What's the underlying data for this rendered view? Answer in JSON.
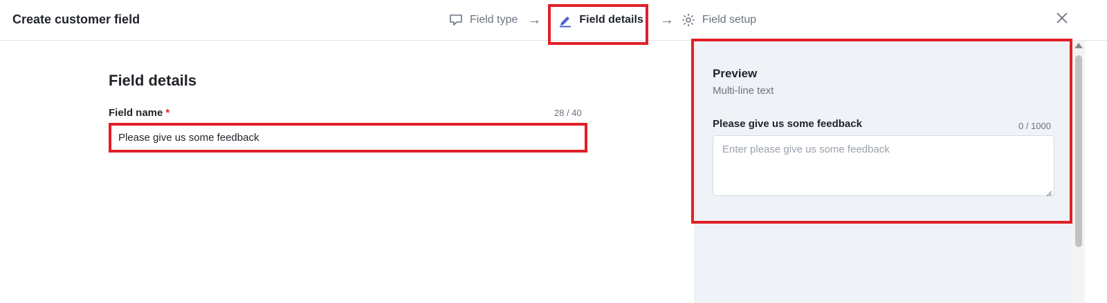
{
  "header": {
    "title": "Create customer field",
    "steps": [
      {
        "label": "Field type",
        "icon": "speech-bubble-icon",
        "active": false
      },
      {
        "label": "Field details",
        "icon": "pen-icon",
        "active": true
      },
      {
        "label": "Field setup",
        "icon": "gear-icon",
        "active": false
      }
    ],
    "arrow": "→",
    "close_icon": "close-icon"
  },
  "form": {
    "title": "Field details",
    "field_name_label": "Field name",
    "required_marker": "*",
    "field_name_counter": "28 / 40",
    "field_name_value": "Please give us some feedback"
  },
  "preview": {
    "title": "Preview",
    "subtitle": "Multi-line text",
    "field_label": "Please give us some feedback",
    "counter": "0 / 1000",
    "placeholder": "Enter please give us some feedback"
  },
  "colors": {
    "accent": "#4a5fd6",
    "highlight": "#e21f26",
    "preview_bg": "#eff2f7",
    "muted_text": "#6b7280"
  }
}
